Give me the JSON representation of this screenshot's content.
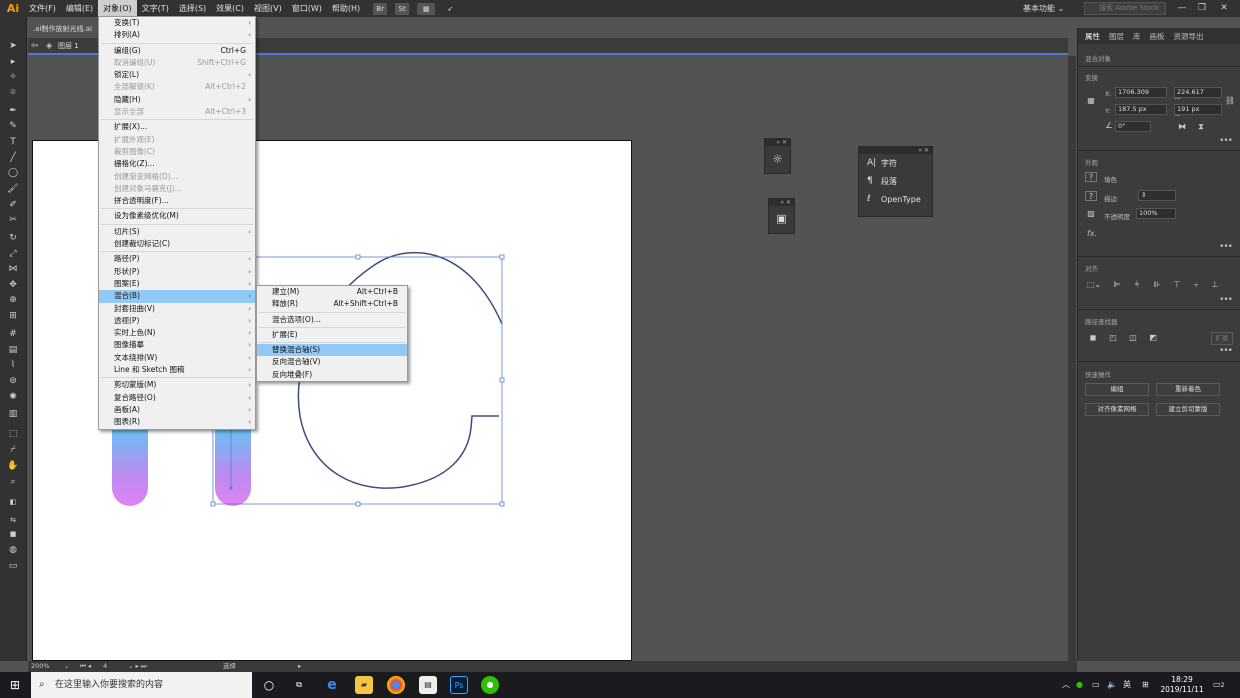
{
  "app": {
    "logo": "Ai"
  },
  "menubar": {
    "items": [
      "文件(F)",
      "编辑(E)",
      "对象(O)",
      "文字(T)",
      "选择(S)",
      "效果(C)",
      "视图(V)",
      "窗口(W)",
      "帮助(H)"
    ],
    "bridge": "Br",
    "stock": "St",
    "workspace": "基本功能",
    "search_placeholder": "搜索 Adobe Stock",
    "minimize": "—",
    "restore": "❐",
    "close": "✕"
  },
  "document": {
    "tab_title": ".ai制作放射光线.ai",
    "layer_label": "图层 1"
  },
  "object_menu": {
    "items": [
      {
        "label": "变换(T)",
        "shortcut": "",
        "sub": true,
        "disabled": false
      },
      {
        "label": "排列(A)",
        "shortcut": "",
        "sub": true,
        "disabled": false
      },
      {
        "sep": true
      },
      {
        "label": "编组(G)",
        "shortcut": "Ctrl+G",
        "sub": false,
        "disabled": false
      },
      {
        "label": "取消编组(U)",
        "shortcut": "Shift+Ctrl+G",
        "sub": false,
        "disabled": true
      },
      {
        "label": "锁定(L)",
        "shortcut": "",
        "sub": true,
        "disabled": false
      },
      {
        "label": "全部解锁(K)",
        "shortcut": "Alt+Ctrl+2",
        "sub": false,
        "disabled": true
      },
      {
        "label": "隐藏(H)",
        "shortcut": "",
        "sub": true,
        "disabled": false
      },
      {
        "label": "显示全部",
        "shortcut": "Alt+Ctrl+3",
        "sub": false,
        "disabled": true
      },
      {
        "sep": true
      },
      {
        "label": "扩展(X)...",
        "shortcut": "",
        "sub": false,
        "disabled": false
      },
      {
        "label": "扩展外观(E)",
        "shortcut": "",
        "sub": false,
        "disabled": true
      },
      {
        "label": "裁剪图像(C)",
        "shortcut": "",
        "sub": false,
        "disabled": true
      },
      {
        "label": "栅格化(Z)...",
        "shortcut": "",
        "sub": false,
        "disabled": false
      },
      {
        "label": "创建渐变网格(D)...",
        "shortcut": "",
        "sub": false,
        "disabled": true
      },
      {
        "label": "创建对象马赛克(J)...",
        "shortcut": "",
        "sub": false,
        "disabled": true
      },
      {
        "label": "拼合透明度(F)...",
        "shortcut": "",
        "sub": false,
        "disabled": false
      },
      {
        "sep": true
      },
      {
        "label": "设为像素级优化(M)",
        "shortcut": "",
        "sub": false,
        "disabled": false
      },
      {
        "sep": true
      },
      {
        "label": "切片(S)",
        "shortcut": "",
        "sub": true,
        "disabled": false
      },
      {
        "label": "创建裁切标记(C)",
        "shortcut": "",
        "sub": false,
        "disabled": false
      },
      {
        "sep": true
      },
      {
        "label": "路径(P)",
        "shortcut": "",
        "sub": true,
        "disabled": false
      },
      {
        "label": "形状(P)",
        "shortcut": "",
        "sub": true,
        "disabled": false
      },
      {
        "label": "图案(E)",
        "shortcut": "",
        "sub": true,
        "disabled": false
      },
      {
        "label": "混合(B)",
        "shortcut": "",
        "sub": true,
        "disabled": false,
        "hl": true
      },
      {
        "label": "封套扭曲(V)",
        "shortcut": "",
        "sub": true,
        "disabled": false
      },
      {
        "label": "透视(P)",
        "shortcut": "",
        "sub": true,
        "disabled": false
      },
      {
        "label": "实时上色(N)",
        "shortcut": "",
        "sub": true,
        "disabled": false
      },
      {
        "label": "图像描摹",
        "shortcut": "",
        "sub": true,
        "disabled": false
      },
      {
        "label": "文本绕排(W)",
        "shortcut": "",
        "sub": true,
        "disabled": false
      },
      {
        "label": "Line 和 Sketch 图稿",
        "shortcut": "",
        "sub": true,
        "disabled": false
      },
      {
        "sep": true
      },
      {
        "label": "剪切蒙版(M)",
        "shortcut": "",
        "sub": true,
        "disabled": false
      },
      {
        "label": "复合路径(O)",
        "shortcut": "",
        "sub": true,
        "disabled": false
      },
      {
        "label": "画板(A)",
        "shortcut": "",
        "sub": true,
        "disabled": false
      },
      {
        "label": "图表(R)",
        "shortcut": "",
        "sub": true,
        "disabled": false
      }
    ]
  },
  "blend_menu": {
    "items": [
      {
        "label": "建立(M)",
        "shortcut": "Alt+Ctrl+B"
      },
      {
        "label": "释放(R)",
        "shortcut": "Alt+Shift+Ctrl+B"
      },
      {
        "sep": true
      },
      {
        "label": "混合选项(O)...",
        "shortcut": ""
      },
      {
        "sep": true
      },
      {
        "label": "扩展(E)",
        "shortcut": ""
      },
      {
        "sep": true
      },
      {
        "label": "替换混合轴(S)",
        "shortcut": "",
        "hl": true
      },
      {
        "label": "反向混合轴(V)",
        "shortcut": ""
      },
      {
        "label": "反向堆叠(F)",
        "shortcut": ""
      }
    ]
  },
  "char_panel": {
    "items": [
      "字符",
      "段落",
      "OpenType"
    ]
  },
  "right_panel": {
    "tabs": [
      "属性",
      "图层",
      "库",
      "画板",
      "资源导出"
    ],
    "object_type": "混合对象",
    "transform_title": "变换",
    "x_label": "X:",
    "x_value": "1706.309",
    "y_label": "Y:",
    "y_value": "187.5 px",
    "w_label": "宽:",
    "w_value": "224.617",
    "h_label": "高:",
    "h_value": "191 px",
    "angle_value": "0°",
    "appearance_title": "外观",
    "fill_label": "填色",
    "stroke_label": "描边",
    "opacity_label": "不透明度",
    "opacity_value": "100%",
    "fx_label": "fx.",
    "align_title": "对齐",
    "pathfinder_title": "路径查找器",
    "pathfinder_expand": "扩展",
    "quick_title": "快速操作",
    "btn_edit": "编组",
    "btn_recolor": "重新着色",
    "btn_align_pixel": "对齐像素网格",
    "btn_create_outline": "建立剪切蒙版"
  },
  "statusbar": {
    "zoom": "200%",
    "artboard_num": "4",
    "tool_name": "选择"
  },
  "taskbar": {
    "search_placeholder": "在这里输入你要搜索的内容",
    "ime": "英",
    "time": "18:29",
    "date": "2019/11/11",
    "notif": "2"
  },
  "colors": {
    "accent": "#4a7ad9",
    "highlight": "#91c9f7",
    "path": "#3e4f7a",
    "gradient_top": "#5ec8f5",
    "gradient_bottom": "#e083f2"
  }
}
